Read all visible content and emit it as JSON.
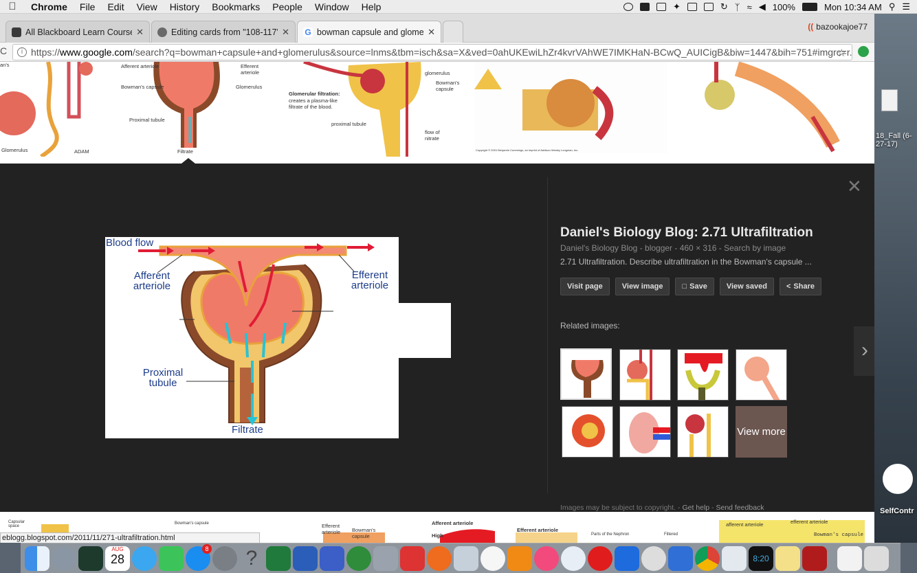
{
  "menubar": {
    "app": "Chrome",
    "items": [
      "File",
      "Edit",
      "View",
      "History",
      "Bookmarks",
      "People",
      "Window",
      "Help"
    ],
    "battery": "100%",
    "clock": "Mon 10:34 AM"
  },
  "tabs": [
    {
      "title": "All Blackboard Learn Courses -",
      "favicon_color": "#3a3a3a"
    },
    {
      "title": "Editing cards from \"108-117\"",
      "favicon_color": "#6a6a6a"
    },
    {
      "title": "bowman capsule and glomerul",
      "favicon_color": "#4285f4"
    }
  ],
  "profile": {
    "name": "bazookajoe77"
  },
  "address": {
    "prefix": "https://",
    "host": "www.google.com",
    "path": "/search?q=bowman+capsule+and+glomerulus&source=lnms&tbm=isch&sa=X&ved=0ahUKEwiLhZr4kvrVAhWE7IMKHaN-BCwQ_AUICigB&biw=1447&bih=751#imgrc=r..."
  },
  "thumbs": {
    "t1": {
      "label_a": "Glomerulus",
      "label_b": "ADAM",
      "label_c": "an's"
    },
    "t2": {
      "afferent": "Afferent arteriole",
      "efferent": "Efferent arteriole",
      "bowmans": "Bowman's capsule",
      "glomerulus": "Glomerulus",
      "proximal": "Proximal tubule",
      "filtrate": "Filtrate"
    },
    "t3": {
      "glomerulus": "glomerulus",
      "bowmans": "Bowman's capsule",
      "filtration_title": "Glomerular filtration:",
      "filtration_desc": "creates a plasma-like filtrate of the blood.",
      "proximal": "proximal tubule",
      "flow": "flow of nitrate"
    },
    "t4": {
      "copyright": "Copyright © 2001 Benjamin Cummings, an imprint of Addison Wesley Longman, Inc."
    }
  },
  "preview": {
    "labels": {
      "blood_flow": "Blood flow",
      "afferent": "Afferent arteriole",
      "efferent": "Efferent arteriole",
      "proximal": "Proximal tubule",
      "filtrate": "Filtrate"
    },
    "title": "Daniel's Biology Blog: 2.71 Ultrafiltration",
    "meta": "Daniel's Biology Blog - blogger - 460 × 316 - Search by image",
    "desc": "2.71 Ultrafiltration. Describe ultrafiltration in the Bowman's capsule ...",
    "buttons": {
      "visit": "Visit page",
      "view_image": "View image",
      "save": "Save",
      "view_saved": "View saved",
      "share": "Share"
    },
    "related_label": "Related images:",
    "view_more": "View more",
    "footer": {
      "note": "Images may be subject to copyright.",
      "help": "Get help",
      "feedback": "Send feedback"
    }
  },
  "bottom": {
    "status_url": "eblogg.blogspot.com/2011/11/271-ultrafiltration.html",
    "labels": {
      "efferent": "Efferent arteriole",
      "bowmans": "Bowman's capsule",
      "afferent": "Afferent arteriole",
      "efferent2": "Efferent arteriole",
      "afferent3": "afferent arteriole",
      "efferent3": "efferent arteriole",
      "bowmans3": "Bowman's capsule",
      "high": "High",
      "parts": "Parts of the Nephron",
      "capsular": "Capsular space",
      "bowmans_small": "Bowman's capsule",
      "filtered": "Filtered"
    }
  },
  "desktop": {
    "file_label": "18_Fall (6-27-17)",
    "app_label": "SelfContr"
  },
  "dock": {
    "calendar_month": "AUG",
    "calendar_day": "28",
    "appstore_badge": "8",
    "clock": "8:20"
  }
}
